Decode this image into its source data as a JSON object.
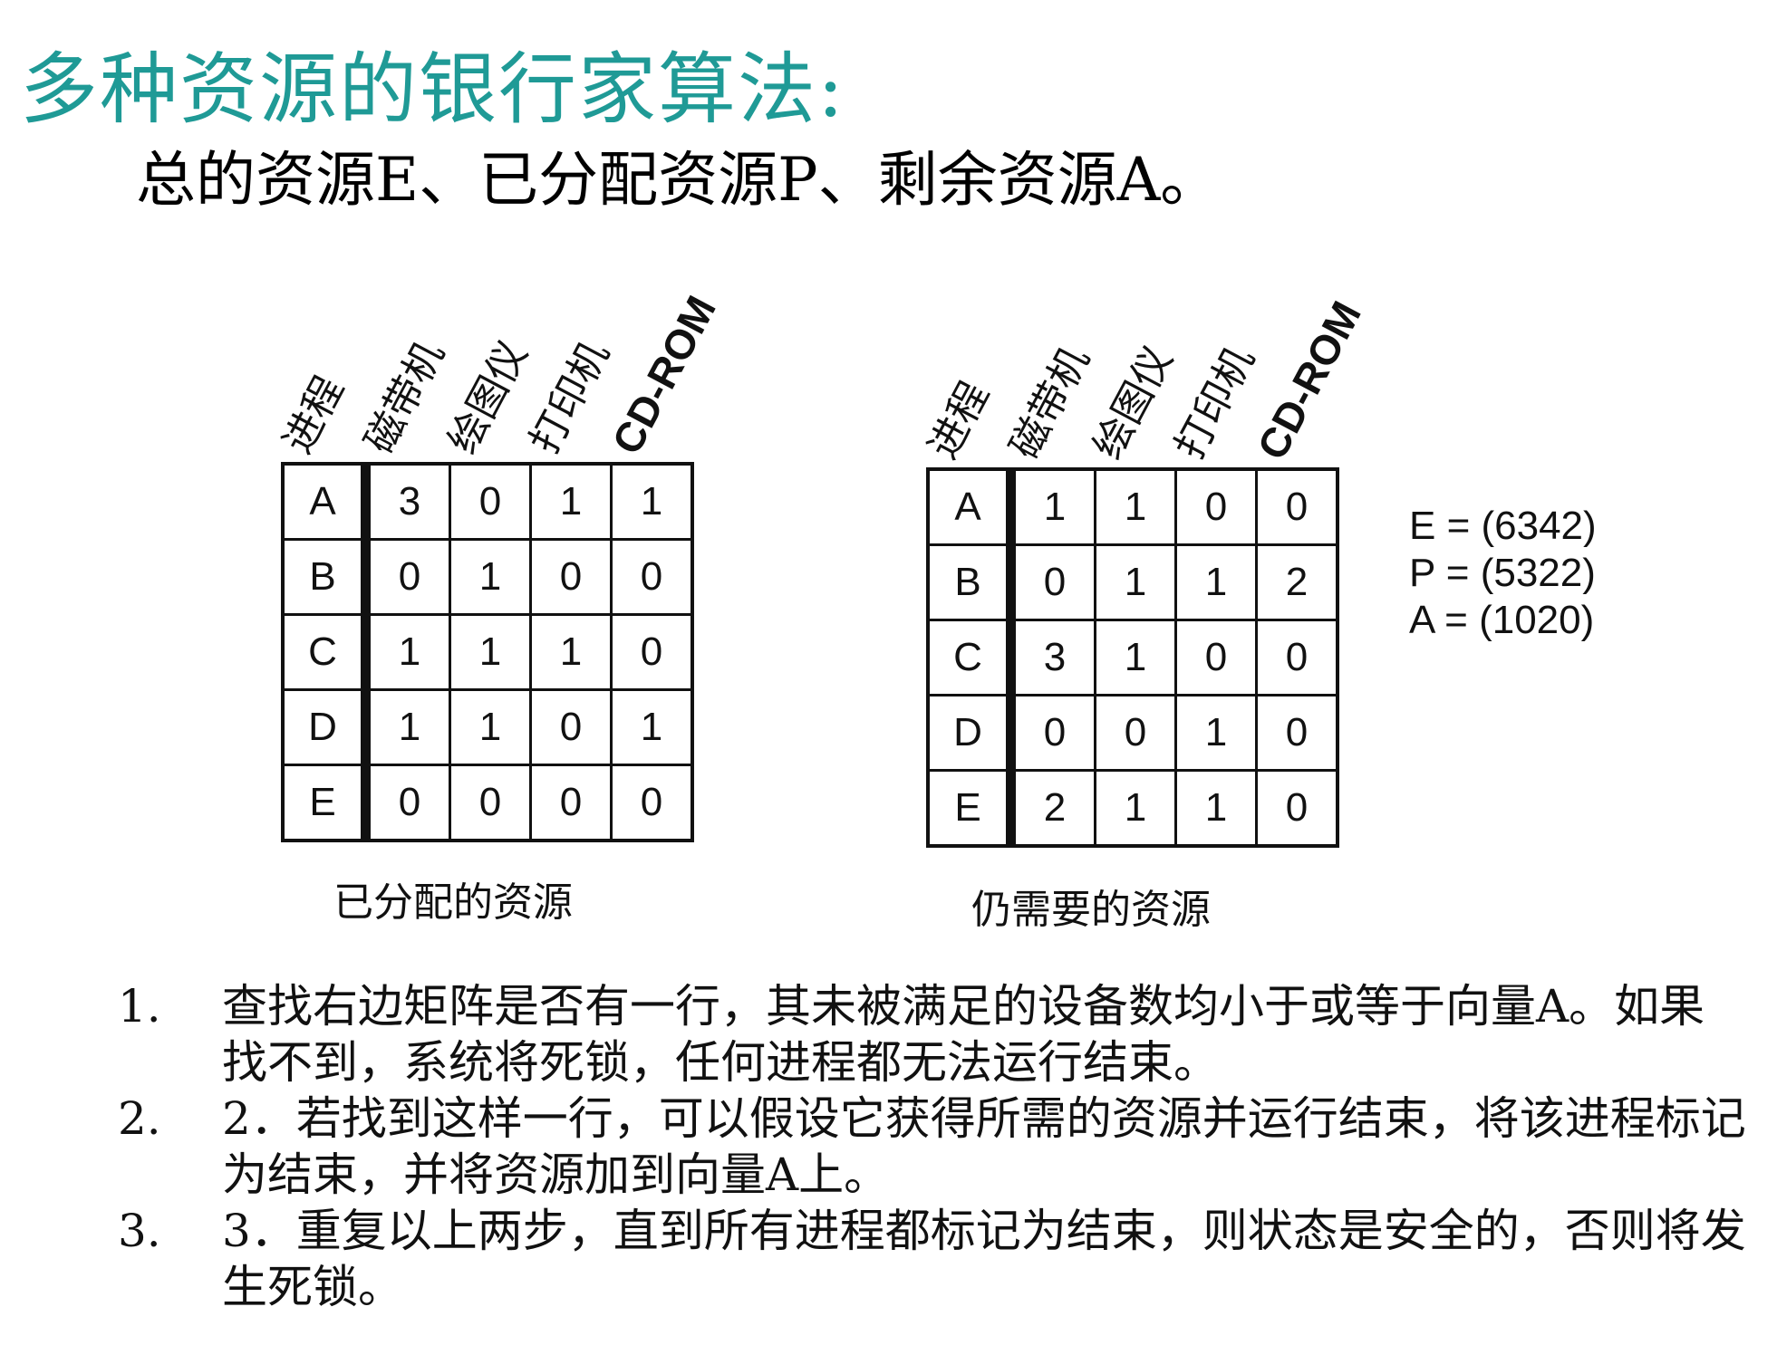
{
  "title": "多种资源的银行家算法:",
  "subtitle": "总的资源E、已分配资源P、剩余资源A。",
  "column_headers": [
    "进程",
    "磁带机",
    "绘图仪",
    "打印机",
    "CD-ROM"
  ],
  "allocated": {
    "caption": "已分配的资源",
    "rows": [
      {
        "process": "A",
        "values": [
          "3",
          "0",
          "1",
          "1"
        ]
      },
      {
        "process": "B",
        "values": [
          "0",
          "1",
          "0",
          "0"
        ]
      },
      {
        "process": "C",
        "values": [
          "1",
          "1",
          "1",
          "0"
        ]
      },
      {
        "process": "D",
        "values": [
          "1",
          "1",
          "0",
          "1"
        ]
      },
      {
        "process": "E",
        "values": [
          "0",
          "0",
          "0",
          "0"
        ]
      }
    ]
  },
  "needed": {
    "caption": "仍需要的资源",
    "rows": [
      {
        "process": "A",
        "values": [
          "1",
          "1",
          "0",
          "0"
        ]
      },
      {
        "process": "B",
        "values": [
          "0",
          "1",
          "1",
          "2"
        ]
      },
      {
        "process": "C",
        "values": [
          "3",
          "1",
          "0",
          "0"
        ]
      },
      {
        "process": "D",
        "values": [
          "0",
          "0",
          "1",
          "0"
        ]
      },
      {
        "process": "E",
        "values": [
          "2",
          "1",
          "1",
          "0"
        ]
      }
    ]
  },
  "vectors": [
    "E = (6342)",
    "P = (5322)",
    "A = (1020)"
  ],
  "steps": [
    {
      "num": "1.",
      "text": "查找右边矩阵是否有一行，其未被满足的设备数均小于或等于向量A。如果找不到，系统将死锁，任何进程都无法运行结束。"
    },
    {
      "num": "2.",
      "text": "2．若找到这样一行，可以假设它获得所需的资源并运行结束，将该进程标记为结束，并将资源加到向量A上。"
    },
    {
      "num": "3.",
      "text": "3．重复以上两步，直到所有进程都标记为结束，则状态是安全的，否则将发生死锁。"
    }
  ]
}
